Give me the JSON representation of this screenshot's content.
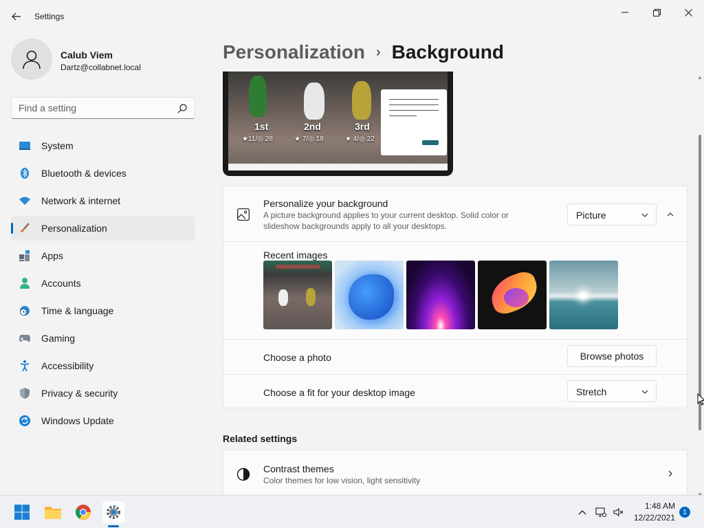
{
  "window": {
    "title": "Settings"
  },
  "profile": {
    "name": "Calub Viem",
    "email": "Dartz@collabnet.local"
  },
  "search": {
    "placeholder": "Find a setting"
  },
  "sidebar": {
    "items": [
      {
        "label": "System",
        "icon": "system-icon",
        "active": false
      },
      {
        "label": "Bluetooth & devices",
        "icon": "bluetooth-icon",
        "active": false
      },
      {
        "label": "Network & internet",
        "icon": "wifi-icon",
        "active": false
      },
      {
        "label": "Personalization",
        "icon": "paintbrush-icon",
        "active": true
      },
      {
        "label": "Apps",
        "icon": "apps-icon",
        "active": false
      },
      {
        "label": "Accounts",
        "icon": "person-icon",
        "active": false
      },
      {
        "label": "Time & language",
        "icon": "clock-globe-icon",
        "active": false
      },
      {
        "label": "Gaming",
        "icon": "gamepad-icon",
        "active": false
      },
      {
        "label": "Accessibility",
        "icon": "accessibility-icon",
        "active": false
      },
      {
        "label": "Privacy & security",
        "icon": "shield-icon",
        "active": false
      },
      {
        "label": "Windows Update",
        "icon": "update-icon",
        "active": false
      }
    ]
  },
  "breadcrumb": {
    "parent": "Personalization",
    "separator": "›",
    "current": "Background"
  },
  "preview": {
    "places": [
      "1st",
      "2nd",
      "3rd"
    ],
    "stats": [
      "★11/◎ 28",
      "★ 7/◎ 18",
      "★ 4/◎ 22"
    ]
  },
  "background_card": {
    "title": "Personalize your background",
    "description": "A picture background applies to your current desktop. Solid color or slideshow backgrounds apply to all your desktops.",
    "type_value": "Picture",
    "recent_images_label": "Recent images",
    "recent_images": [
      {
        "name": "game-results-wallpaper"
      },
      {
        "name": "blue-bloom-wallpaper"
      },
      {
        "name": "purple-glow-wallpaper"
      },
      {
        "name": "colorful-ribbon-wallpaper"
      },
      {
        "name": "lake-sunrise-wallpaper"
      }
    ],
    "choose_photo_label": "Choose a photo",
    "browse_button": "Browse photos",
    "fit_label": "Choose a fit for your desktop image",
    "fit_value": "Stretch"
  },
  "related": {
    "title": "Related settings",
    "items": [
      {
        "title": "Contrast themes",
        "description": "Color themes for low vision, light sensitivity"
      }
    ]
  },
  "taskbar": {
    "time": "1:48 AM",
    "date": "12/22/2021",
    "notification_count": "1"
  },
  "colors": {
    "accent": "#0067c0",
    "background": "#f3f3f3",
    "card": "#fbfbfb"
  }
}
